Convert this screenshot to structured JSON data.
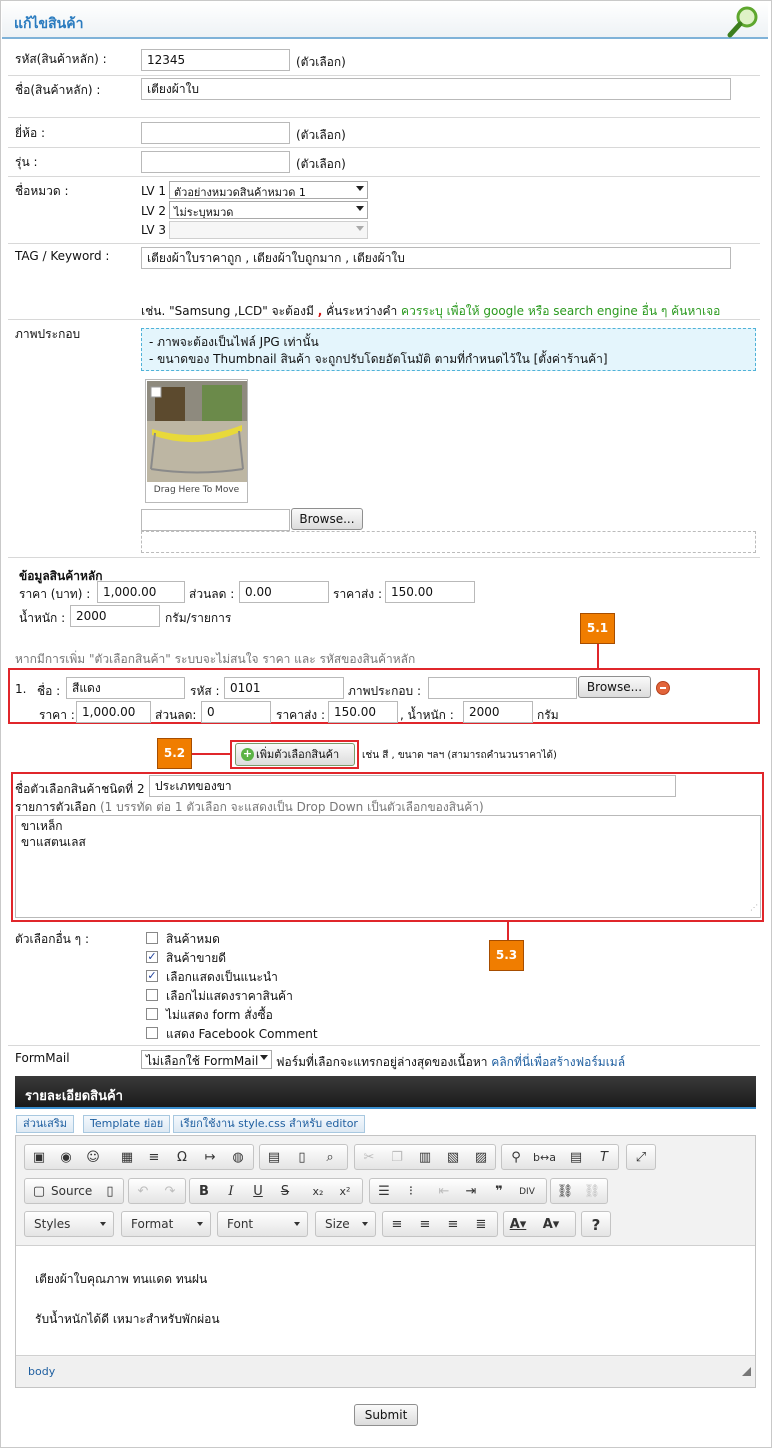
{
  "page_title": "แก้ไขสินค้า",
  "optional": "(ตัวเลือก)",
  "fields": {
    "code_label": "รหัส(สินค้าหลัก) :",
    "code_value": "12345",
    "name_label": "ชื่อ(สินค้าหลัก) :",
    "name_value": "เตียงผ้าใบ",
    "brand_label": "ยี่ห้อ :",
    "model_label": "รุ่น :",
    "category_label": "ชื่อหมวด :",
    "lv1_label": "LV 1",
    "lv1_value": "ตัวอย่างหมวดสินค้าหมวด 1",
    "lv2_label": "LV 2",
    "lv2_value": "ไม่ระบุหมวด",
    "lv3_label": "LV 3",
    "lv3_value": "",
    "tag_label": "TAG / Keyword :",
    "tag_value": "เตียงผ้าใบราคาถูก , เตียงผ้าใบถูกมาก , เตียงผ้าใบ",
    "tag_hint_1": "เช่น. \"Samsung ,LCD\" จะต้องมี",
    "tag_hint_comma": ",",
    "tag_hint_2": "คั่นระหว่างคำ",
    "tag_hint_3": "ควรระบุ เพื่อให้ google หรือ search engine อื่น ๆ ค้นหาเจอ"
  },
  "images": {
    "label": "ภาพประกอบ",
    "info_1": "- ภาพจะต้องเป็นไฟล์ JPG เท่านั้น",
    "info_2": "- ขนาดของ Thumbnail สินค้า จะถูกปรับโดยอัตโนมัติ ตามที่กำหนดไว้ใน [ตั้งค่าร้านค้า]",
    "drag_text": "Drag Here To Move",
    "browse_label": "Browse..."
  },
  "main_info": {
    "heading": "ข้อมูลสินค้าหลัก",
    "price_label": "ราคา (บาท) :",
    "price_value": "1,000.00",
    "discount_label": "ส่วนลด :",
    "discount_value": "0.00",
    "wholesale_label": "ราคาส่ง :",
    "wholesale_value": "150.00",
    "weight_label": "น้ำหนัก :",
    "weight_value": "2000",
    "weight_unit": "กรัม/รายการ",
    "variant_note": "หากมีการเพิ่ม \"ตัวเลือกสินค้า\" ระบบจะไม่สนใจ ราคา และ รหัสของสินค้าหลัก"
  },
  "variant": {
    "index": "1.",
    "name_label": "ชื่อ :",
    "name_value": "สีแดง",
    "code_label": "รหัส :",
    "code_value": "0101",
    "image_label": "ภาพประกอบ :",
    "browse_label": "Browse...",
    "price_label": "ราคา :",
    "price_value": "1,000.00",
    "discount_label": "ส่วนลด:",
    "discount_value": "0",
    "wholesale_label": "ราคาส่ง :",
    "wholesale_value": "150.00",
    "weight_label": ", น้ำหนัก :",
    "weight_value": "2000",
    "weight_unit": "กรัม"
  },
  "add_variant": {
    "button_label": "เพิ่มตัวเลือกสินค้า",
    "hint": "เช่น สี , ขนาด ฯลฯ (สามารถคำนวนราคาได้)"
  },
  "option_type": {
    "name_label": "ชื่อตัวเลือกสินค้าชนิดที่ 2",
    "name_value": "ประเภทของขา",
    "list_label": "รายการตัวเลือก",
    "list_hint": "(1 บรรทัด ต่อ 1 ตัวเลือก จะแสดงเป็น Drop Down เป็นตัวเลือกของสินค้า)",
    "line_1": "ขาเหล็ก",
    "line_2": "ขาแสตนเลส"
  },
  "callouts": {
    "c1": "5.1",
    "c2": "5.2",
    "c3": "5.3"
  },
  "other_options": {
    "label": "ตัวเลือกอื่น ๆ :",
    "items": [
      {
        "label": "สินค้าหมด",
        "checked": false
      },
      {
        "label": "สินค้าขายดี",
        "checked": true
      },
      {
        "label": "เลือกแสดงเป็นแนะนำ",
        "checked": true
      },
      {
        "label": "เลือกไม่แสดงราคาสินค้า",
        "checked": false
      },
      {
        "label": "ไม่แสดง form สั่งซื้อ",
        "checked": false
      },
      {
        "label": "แสดง Facebook Comment",
        "checked": false
      }
    ]
  },
  "formmail": {
    "label": "FormMail",
    "select_value": "ไม่เลือกใช้ FormMail",
    "hint": "ฟอร์มที่เลือกจะแทรกอยู่ล่างสุดของเนื้อหา",
    "link": "คลิกที่นี่เพื่อสร้างฟอร์มเมล์"
  },
  "editor": {
    "title": "รายละเอียดสินค้า",
    "tabs": [
      "ส่วนเสริม",
      "Template ย่อย",
      "เรียกใช้งาน style.css สำหรับ editor"
    ],
    "source_label": "Source",
    "styles_label": "Styles",
    "format_label": "Format",
    "font_label": "Font",
    "size_label": "Size",
    "paragraph_1": "เตียงผ้าใบคุณภาพ ทนแดด ทนฝน",
    "paragraph_2": "รับน้ำหนักได้ดี เหมาะสำหรับพักผ่อน",
    "status_path": "body"
  },
  "submit_label": "Submit"
}
